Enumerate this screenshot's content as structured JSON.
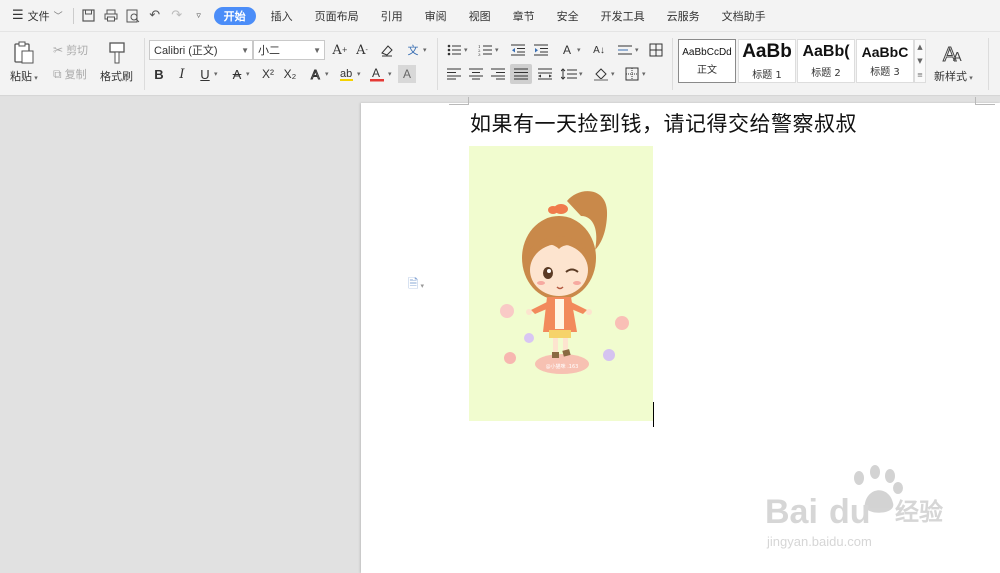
{
  "menu": {
    "file_label": "文件",
    "tabs": [
      "开始",
      "插入",
      "页面布局",
      "引用",
      "审阅",
      "视图",
      "章节",
      "安全",
      "开发工具",
      "云服务",
      "文档助手"
    ],
    "active_tab": "开始"
  },
  "clipboard": {
    "paste_label": "粘贴",
    "cut_label": "剪切",
    "copy_label": "复制",
    "format_painter_label": "格式刷"
  },
  "font": {
    "font_name": "Calibri (正文)",
    "font_size": "小二",
    "bold": "B",
    "italic": "I",
    "underline": "U",
    "strikethrough": "A",
    "superscript": "X²",
    "subscript": "X₂",
    "font_color": "A",
    "char_shading": "A"
  },
  "styles": [
    {
      "sample": "AaBbCcDd",
      "name": "正文"
    },
    {
      "sample": "AaBb",
      "name": "标题 1"
    },
    {
      "sample": "AaBb(",
      "name": "标题 2"
    },
    {
      "sample": "AaBbC",
      "name": "标题 3"
    }
  ],
  "new_style_label": "新样式",
  "document": {
    "heading_text": "如果有一天捡到钱，请记得交给警察叔叔",
    "image_caption": "@小猫咪 .163"
  },
  "watermark": {
    "brand": "Bai",
    "brand2": "du",
    "cn": "经验",
    "url": "jingyan.baidu.com"
  },
  "colors": {
    "accent": "#4b8df8",
    "image_bg": "#f1fccf",
    "font_color_bar": "#e53935"
  }
}
